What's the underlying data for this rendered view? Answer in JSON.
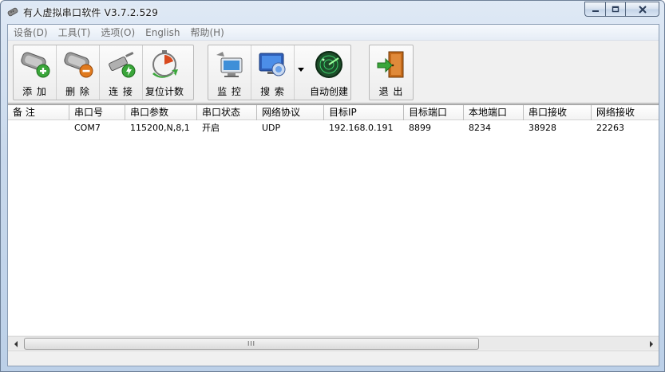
{
  "window": {
    "title": "有人虚拟串口软件 V3.7.2.529"
  },
  "menu": {
    "items": [
      {
        "label": "设备(D)"
      },
      {
        "label": "工具(T)"
      },
      {
        "label": "选项(O)"
      },
      {
        "label": "English"
      },
      {
        "label": "帮助(H)"
      }
    ]
  },
  "toolbar": {
    "add": "添 加",
    "delete": "删 除",
    "connect": "连 接",
    "reset_count": "复位计数",
    "monitor": "监 控",
    "search": "搜 索",
    "auto_create": "自动创建",
    "exit": "退 出"
  },
  "table": {
    "columns": [
      {
        "label": "备 注"
      },
      {
        "label": "串口号"
      },
      {
        "label": "串口参数"
      },
      {
        "label": "串口状态"
      },
      {
        "label": "网络协议"
      },
      {
        "label": "目标IP"
      },
      {
        "label": "目标端口"
      },
      {
        "label": "本地端口"
      },
      {
        "label": "串口接收"
      },
      {
        "label": "网络接收"
      }
    ],
    "rows": [
      {
        "note": "",
        "port": "COM7",
        "params": "115200,N,8,1",
        "status": "开启",
        "protocol": "UDP",
        "target_ip": "192.168.0.191",
        "target_port": "8899",
        "local_port": "8234",
        "serial_rx": "38928",
        "net_rx": "22263"
      }
    ]
  },
  "scrollbar": {
    "grip": "III"
  },
  "colors": {
    "accent_green": "#3aa63a",
    "accent_red": "#d94a1e",
    "frame": "#c9d9ec"
  }
}
